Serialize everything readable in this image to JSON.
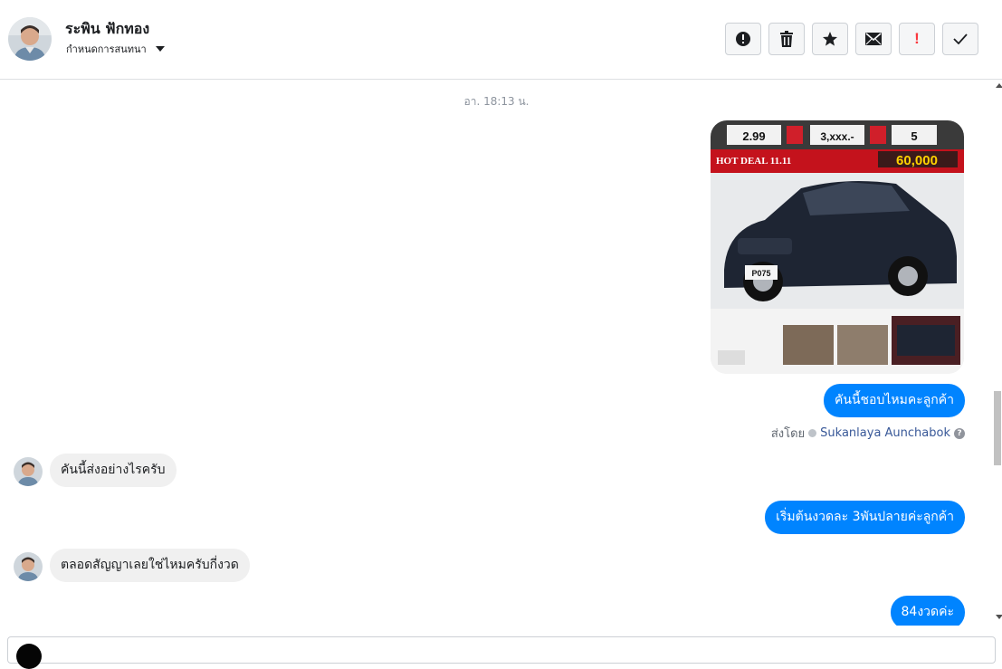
{
  "header": {
    "contact_name": "ระพิน ฟักทอง",
    "assign_label": "กำหนดการสนทนา",
    "actions": [
      {
        "name": "mark-spam",
        "icon": "alert-circle-icon"
      },
      {
        "name": "delete",
        "icon": "trash-icon"
      },
      {
        "name": "star",
        "icon": "star-icon"
      },
      {
        "name": "mark-unread",
        "icon": "envelope-icon"
      },
      {
        "name": "follow-up",
        "icon": "exclamation-icon",
        "text": "!"
      },
      {
        "name": "mark-done",
        "icon": "check-icon"
      }
    ]
  },
  "conversation": {
    "timestamp": "อา. 18:13 น.",
    "image_ad": {
      "top_values": [
        "2.99",
        "3,xxx.-",
        "5"
      ],
      "hot_deal": "HOT DEAL 11.11",
      "discount": "60,000",
      "plate": "P075"
    },
    "messages": [
      {
        "direction": "out",
        "text": "คันนี้ชอบไหมคะลูกค้า"
      },
      {
        "direction": "in",
        "text": "คันนี้ส่งอย่างไรครับ"
      },
      {
        "direction": "out",
        "text": "เริ่มต้นงวดละ 3พันปลายค่ะลูกค้า"
      },
      {
        "direction": "in",
        "text": "ตลอดสัญญาเลยใช่ไหมครับกี่งวด"
      },
      {
        "direction": "out",
        "text": "84งวดค่ะ"
      }
    ],
    "sent_by": {
      "prefix": "ส่งโดย",
      "agent": "Sukanlaya Aunchabok",
      "help": "?"
    }
  },
  "colors": {
    "outgoing_bubble": "#0084ff",
    "incoming_bubble": "#f0f0f0",
    "follow_up_icon": "#fa383e"
  }
}
